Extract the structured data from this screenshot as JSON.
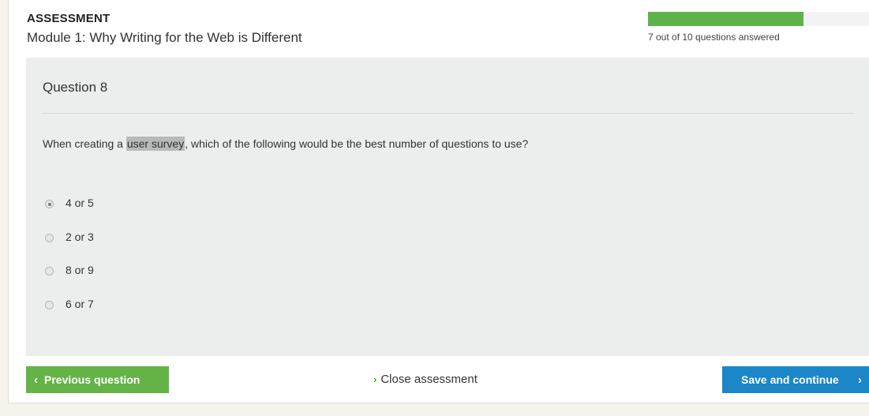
{
  "header": {
    "label": "ASSESSMENT",
    "module_title": "Module 1: Why Writing for the Web is Different"
  },
  "progress": {
    "answered": 7,
    "total": 10,
    "fraction": 0.7,
    "text": "7 out of 10 questions answered",
    "fill_color": "#5db24a"
  },
  "question": {
    "title": "Question 8",
    "text_before": "When creating a ",
    "highlighted": "user survey",
    "text_after": ", which of the following would be the best number of questions to use?",
    "options": [
      {
        "label": "4 or 5",
        "selected": true
      },
      {
        "label": "2 or 3",
        "selected": false
      },
      {
        "label": "8 or 9",
        "selected": false
      },
      {
        "label": "6 or 7",
        "selected": false
      }
    ]
  },
  "footer": {
    "prev_label": "Previous question",
    "close_label": "Close assessment",
    "save_label": "Save and continue",
    "prev_color": "#64b347",
    "save_color": "#1b86c8"
  }
}
